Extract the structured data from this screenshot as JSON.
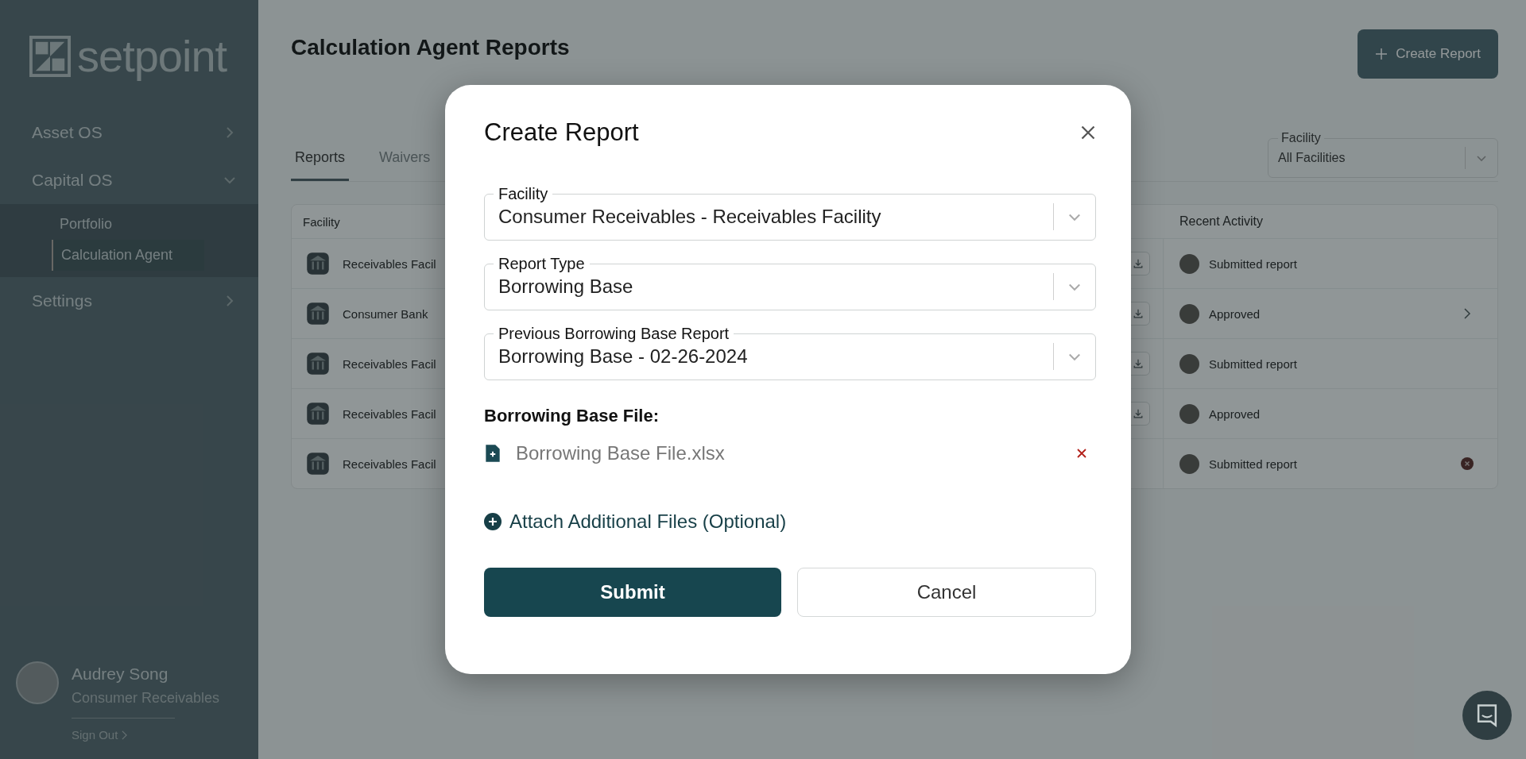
{
  "sidebar": {
    "logo": "setpoint",
    "nav": [
      {
        "label": "Asset OS",
        "expanded": false
      },
      {
        "label": "Capital OS",
        "expanded": true,
        "children": [
          {
            "label": "Portfolio",
            "selected": false
          },
          {
            "label": "Calculation Agent",
            "selected": true
          }
        ]
      },
      {
        "label": "Settings",
        "expanded": false
      }
    ],
    "user": {
      "name": "Audrey Song",
      "organization": "Consumer Receivables",
      "sign_out": "Sign Out"
    }
  },
  "page": {
    "title": "Calculation Agent Reports",
    "create_button": "Create Report"
  },
  "tabs": [
    {
      "label": "Reports",
      "selected": true
    },
    {
      "label": "Waivers",
      "selected": false
    }
  ],
  "facility_filter": {
    "label": "Facility",
    "value": "All Facilities"
  },
  "table": {
    "columns": [
      "Facility",
      "Recent Activity"
    ],
    "rows": [
      {
        "facility": "Receivables Facil",
        "download": true,
        "activity": "Submitted report",
        "openable": false,
        "rejected": false
      },
      {
        "facility": "Consumer Bank",
        "download": true,
        "activity": "Approved",
        "openable": true,
        "rejected": false
      },
      {
        "facility": "Receivables Facil",
        "download": true,
        "activity": "Submitted report",
        "openable": false,
        "rejected": false
      },
      {
        "facility": "Receivables Facil",
        "download": true,
        "activity": "Approved",
        "openable": false,
        "rejected": false
      },
      {
        "facility": "Receivables Facil",
        "download": false,
        "activity": "Submitted report",
        "openable": false,
        "rejected": true
      }
    ]
  },
  "modal": {
    "title": "Create Report",
    "fields": [
      {
        "label": "Facility",
        "value": "Consumer Receivables - Receivables Facility"
      },
      {
        "label": "Report Type",
        "value": "Borrowing Base"
      },
      {
        "label": "Previous Borrowing Base Report",
        "value": "Borrowing Base - 02-26-2024"
      }
    ],
    "file_heading": "Borrowing Base File:",
    "file_name": "Borrowing Base File.xlsx",
    "attach_link": "Attach Additional Files (Optional)",
    "submit": "Submit",
    "cancel": "Cancel"
  }
}
